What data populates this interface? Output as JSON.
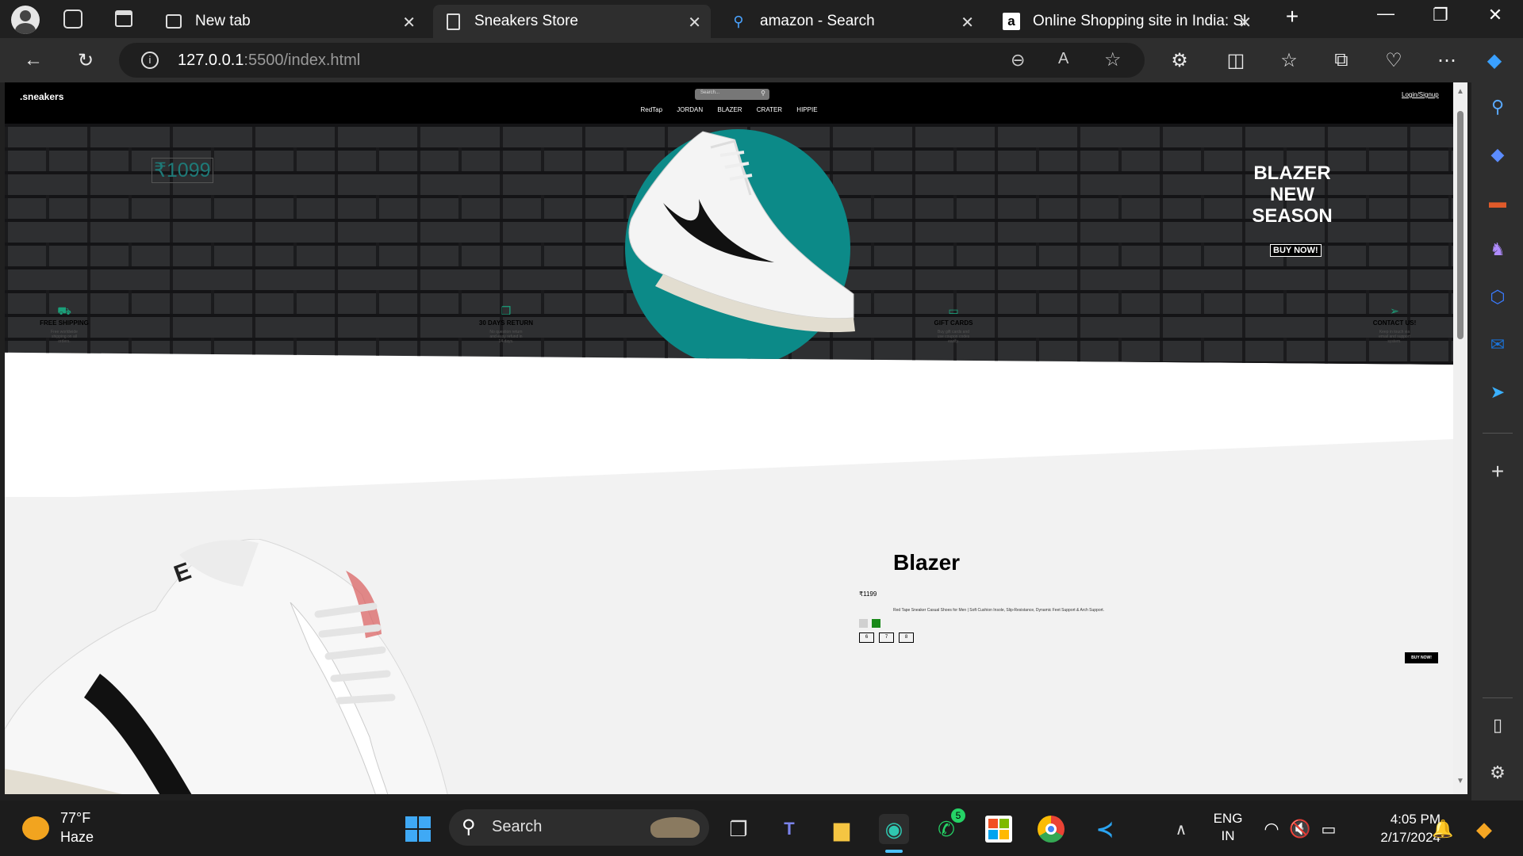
{
  "browser": {
    "tabs": [
      {
        "title": "New tab",
        "icon": "new-tab-icon",
        "active": false
      },
      {
        "title": "Sneakers Store",
        "icon": "page-icon",
        "active": true
      },
      {
        "title": "amazon - Search",
        "icon": "search-icon",
        "active": false
      },
      {
        "title": "Online Shopping site in India: Sh",
        "icon": "amazon-icon",
        "active": false
      }
    ],
    "url_host": "127.0.0.1",
    "url_path": ":5500/index.html"
  },
  "site": {
    "logo": ".sneakers",
    "search_placeholder": "Search...",
    "menu": [
      "RedTap",
      "JORDAN",
      "BLAZER",
      "CRATER",
      "HIPPIE"
    ],
    "login": "Login/Signup",
    "hero": {
      "price": "₹1099",
      "headline": [
        "BLAZER",
        "NEW",
        "SEASON"
      ],
      "cta": "BUY NOW!",
      "accent_color": "#0c8a88"
    },
    "features": [
      {
        "title": "FREE SHIPPING",
        "desc": "Free worldwide shipping on all orders.",
        "icon": "truck-icon"
      },
      {
        "title": "30 DAYS RETURN",
        "desc": "No question return and easy refund in 14 days.",
        "icon": "return-box-icon"
      },
      {
        "title": "GIFT CARDS",
        "desc": "Buy gift cards and use coupon codes easily.",
        "icon": "gift-card-icon"
      },
      {
        "title": "CONTACT US!",
        "desc": "Keep in touch via email and support system.",
        "icon": "paper-plane-icon"
      }
    ],
    "product": {
      "name": "Blazer",
      "price": "₹1199",
      "desc": "Red Tape Sneaker Casual Shoes for Men | Soft Cushion Insole, Slip-Resistance, Dynamic Feet Support & Arch Support.",
      "colors": [
        "#d0d0d0",
        "#1a8a1a"
      ],
      "sizes": [
        "6",
        "7",
        "8"
      ],
      "cta": "BUY NOW!"
    }
  },
  "taskbar": {
    "weather_temp": "77°F",
    "weather_desc": "Haze",
    "search_label": "Search",
    "whatsapp_badge": "5",
    "lang_top": "ENG",
    "lang_bottom": "IN",
    "time": "4:05 PM",
    "date": "2/17/2024"
  }
}
